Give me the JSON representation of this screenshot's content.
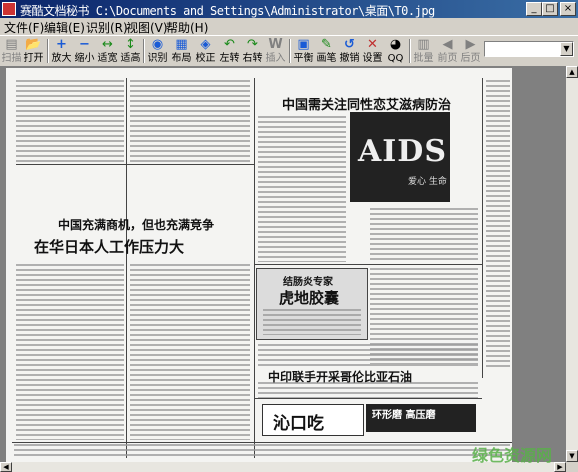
{
  "window": {
    "title": "赛酷文档秘书 C:\\Documents and Settings\\Administrator\\桌面\\T0.jpg",
    "buttons": {
      "minimize": "_",
      "maximize": "□",
      "close": "×"
    }
  },
  "menu": [
    "文件(F)",
    "编辑(E)",
    "识别(R)",
    "视图(V)",
    "帮助(H)"
  ],
  "toolbar": {
    "buttons": [
      {
        "label": "扫描",
        "icon": "scanner-icon",
        "glyph": "▤",
        "enabled": false
      },
      {
        "label": "打开",
        "icon": "open-folder-icon",
        "glyph": "📂",
        "enabled": true
      },
      {
        "label": "放大",
        "icon": "zoom-in-icon",
        "glyph": "+",
        "enabled": true
      },
      {
        "label": "缩小",
        "icon": "zoom-out-icon",
        "glyph": "−",
        "enabled": true
      },
      {
        "label": "适宽",
        "icon": "fit-width-icon",
        "glyph": "↔",
        "enabled": true
      },
      {
        "label": "适高",
        "icon": "fit-height-icon",
        "glyph": "↕",
        "enabled": true
      },
      {
        "label": "识别",
        "icon": "recognize-icon",
        "glyph": "◉",
        "enabled": true
      },
      {
        "label": "布局",
        "icon": "layout-icon",
        "glyph": "▦",
        "enabled": true
      },
      {
        "label": "校正",
        "icon": "correct-icon",
        "glyph": "◈",
        "enabled": true
      },
      {
        "label": "左转",
        "icon": "rotate-left-icon",
        "glyph": "↶",
        "enabled": true
      },
      {
        "label": "右转",
        "icon": "rotate-right-icon",
        "glyph": "↷",
        "enabled": true
      },
      {
        "label": "插入",
        "icon": "insert-icon",
        "glyph": "W",
        "enabled": false
      },
      {
        "label": "平衡",
        "icon": "balance-icon",
        "glyph": "▣",
        "enabled": true
      },
      {
        "label": "画笔",
        "icon": "pen-icon",
        "glyph": "✎",
        "enabled": true
      },
      {
        "label": "撤销",
        "icon": "undo-icon",
        "glyph": "↺",
        "enabled": true
      },
      {
        "label": "设置",
        "icon": "settings-icon",
        "glyph": "✕",
        "enabled": true
      },
      {
        "label": "QQ",
        "icon": "qq-icon",
        "glyph": "◕",
        "enabled": true
      },
      {
        "label": "批量",
        "icon": "batch-icon",
        "glyph": "▥",
        "enabled": false
      },
      {
        "label": "前页",
        "icon": "prev-page-icon",
        "glyph": "◀",
        "enabled": false
      },
      {
        "label": "后页",
        "icon": "next-page-icon",
        "glyph": "▶",
        "enabled": false
      }
    ],
    "dropdown_value": ""
  },
  "document": {
    "headlines": [
      "中国需关注同性恋艾滋病防治",
      "中国充满商机，但也充满竞争",
      "在华日本人工作压力大",
      "中印联手开采哥伦比亚石油",
      "结肠炎专家",
      "虎地胶囊",
      "沁口吃",
      "环形磨 高压磨",
      "AIDS",
      "爱心 生命 艾滋"
    ]
  },
  "watermark": "绿色资源网"
}
